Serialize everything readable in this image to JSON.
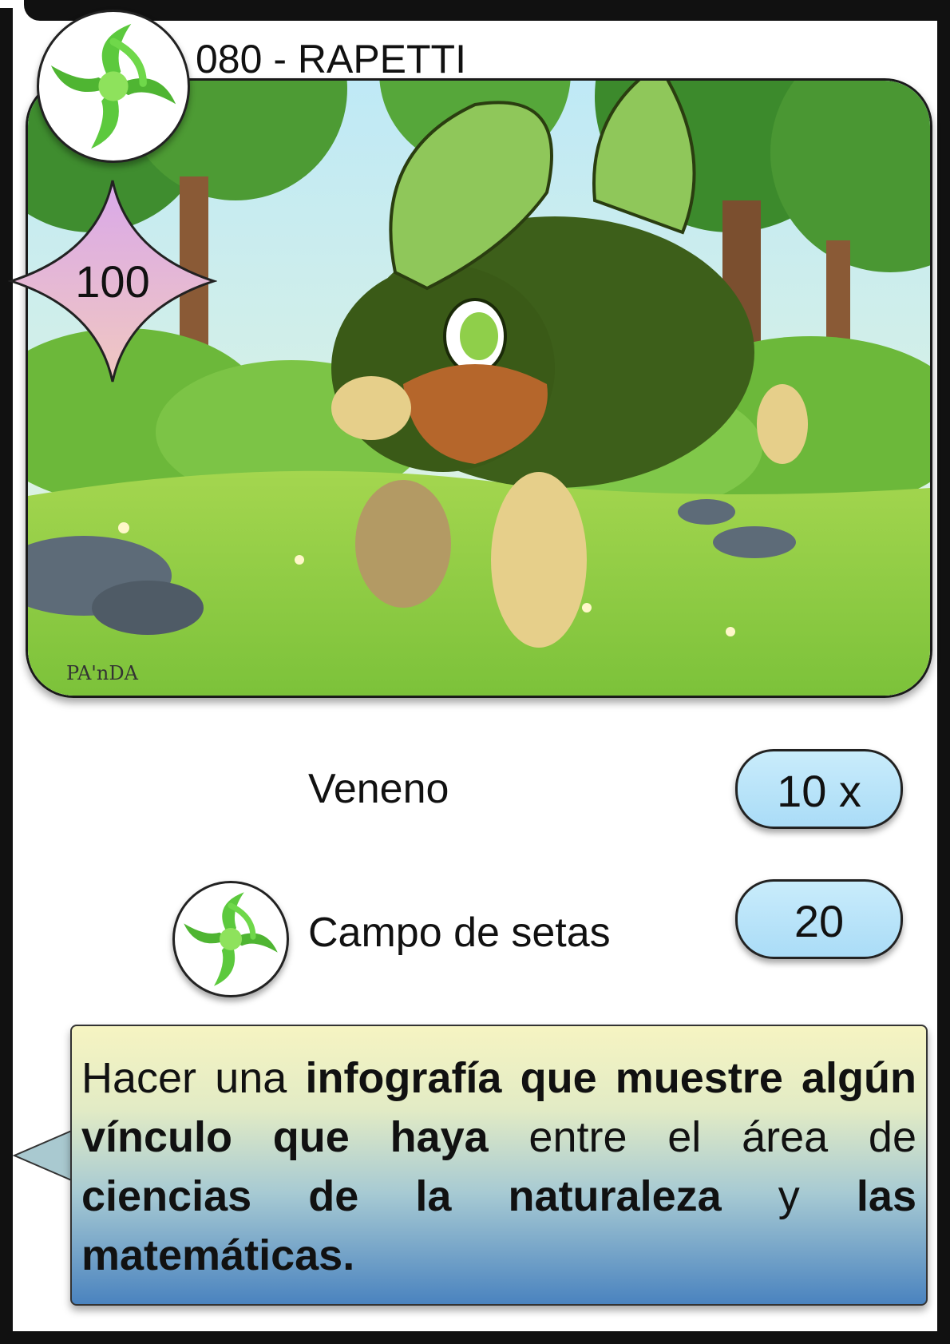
{
  "card": {
    "title": "080 - RAPETTI",
    "hp": "100",
    "type_icon": "grass-swirl-icon",
    "artist_signature": "PA'nDA"
  },
  "attacks": [
    {
      "name": "Veneno",
      "damage": "10 x",
      "energy_icon": null
    },
    {
      "name": "Campo de setas",
      "damage": "20",
      "energy_icon": "grass-swirl-icon"
    }
  ],
  "description": {
    "segments": [
      {
        "text": "Hacer una ",
        "bold": false
      },
      {
        "text": "infografía que muestre algún vínculo que haya",
        "bold": true
      },
      {
        "text": " entre el área de ",
        "bold": false
      },
      {
        "text": "ciencias de la naturaleza",
        "bold": true
      },
      {
        "text": " y ",
        "bold": false
      },
      {
        "text": "las matemáticas.",
        "bold": true
      }
    ]
  },
  "colors": {
    "grass_type": "#5cc93d",
    "hp_star_top": "#d9a8ea",
    "hp_star_bottom": "#f1c8c0",
    "damage_pill": "#b8e3f9",
    "text_box_top": "#f6f4c2",
    "text_box_bottom": "#4a83bf"
  }
}
